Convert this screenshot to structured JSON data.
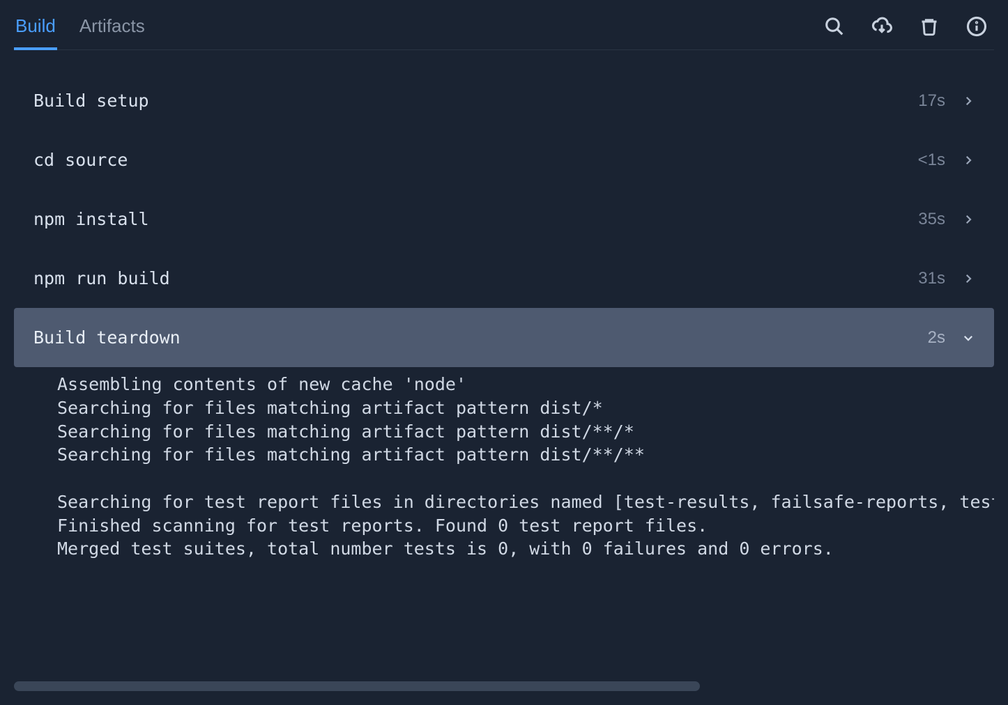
{
  "tabs": [
    {
      "label": "Build",
      "active": true
    },
    {
      "label": "Artifacts",
      "active": false
    }
  ],
  "steps": [
    {
      "name": "Build setup",
      "duration": "17s",
      "expanded": false
    },
    {
      "name": "cd source",
      "duration": "<1s",
      "expanded": false
    },
    {
      "name": "npm install",
      "duration": "35s",
      "expanded": false
    },
    {
      "name": "npm run build",
      "duration": "31s",
      "expanded": false
    },
    {
      "name": "Build teardown",
      "duration": "2s",
      "expanded": true
    }
  ],
  "log_lines": [
    "Assembling contents of new cache 'node'",
    "Searching for files matching artifact pattern dist/*",
    "Searching for files matching artifact pattern dist/**/*",
    "Searching for files matching artifact pattern dist/**/**",
    "",
    "Searching for test report files in directories named [test-results, failsafe-reports, test-repo",
    "Finished scanning for test reports. Found 0 test report files.",
    "Merged test suites, total number tests is 0, with 0 failures and 0 errors."
  ]
}
